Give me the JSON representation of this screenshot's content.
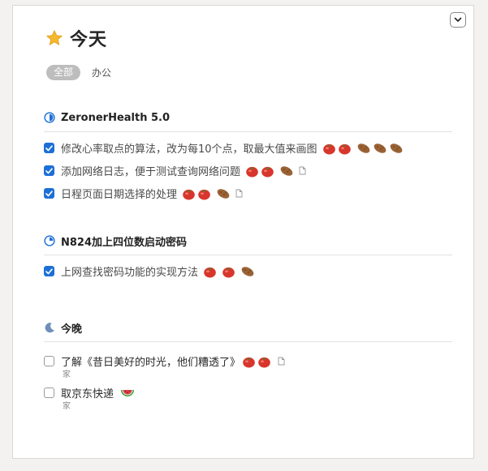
{
  "page": {
    "title": "今天",
    "filters": [
      {
        "label": "全部",
        "selected": true
      },
      {
        "label": "办公",
        "selected": false
      }
    ]
  },
  "sections": [
    {
      "name": "ZeronerHealth 5.0",
      "icon": "half-circle-progress-icon",
      "tasks": [
        {
          "text": "修改心率取点的算法，改为每10个点，取最大值来画图",
          "checked": true,
          "tomatoes": 2,
          "potatoes": 3,
          "note": false
        },
        {
          "text": "添加网络日志，便于测试查询网络问题",
          "checked": true,
          "tomatoes": 2,
          "potatoes": 1,
          "note": true
        },
        {
          "text": "日程页面日期选择的处理",
          "checked": true,
          "tomatoes": 2,
          "potatoes": 1,
          "note": true
        }
      ]
    },
    {
      "name": "N824加上四位数启动密码",
      "icon": "quarter-circle-progress-icon",
      "tasks": [
        {
          "text": "上网查找密码功能的实现方法",
          "checked": true,
          "tomatoes": 2,
          "potatoes": 1,
          "note": false
        }
      ]
    },
    {
      "name": "今晚",
      "icon": "crescent-moon-icon",
      "tasks": [
        {
          "text": "了解《昔日美好的时光，他们糟透了》",
          "checked": false,
          "tomatoes": 2,
          "potatoes": 0,
          "note": true,
          "tag": "家"
        },
        {
          "text": "取京东快递",
          "checked": false,
          "tomatoes": 0,
          "potatoes": 0,
          "watermelon": true,
          "note": false,
          "tag": "家"
        }
      ]
    }
  ],
  "colors": {
    "accent": "#1d6fd6",
    "chip_bg": "#bdbdbd",
    "star": "#f5b82e",
    "tomato": "#d8362c",
    "potato": "#9a6234"
  }
}
